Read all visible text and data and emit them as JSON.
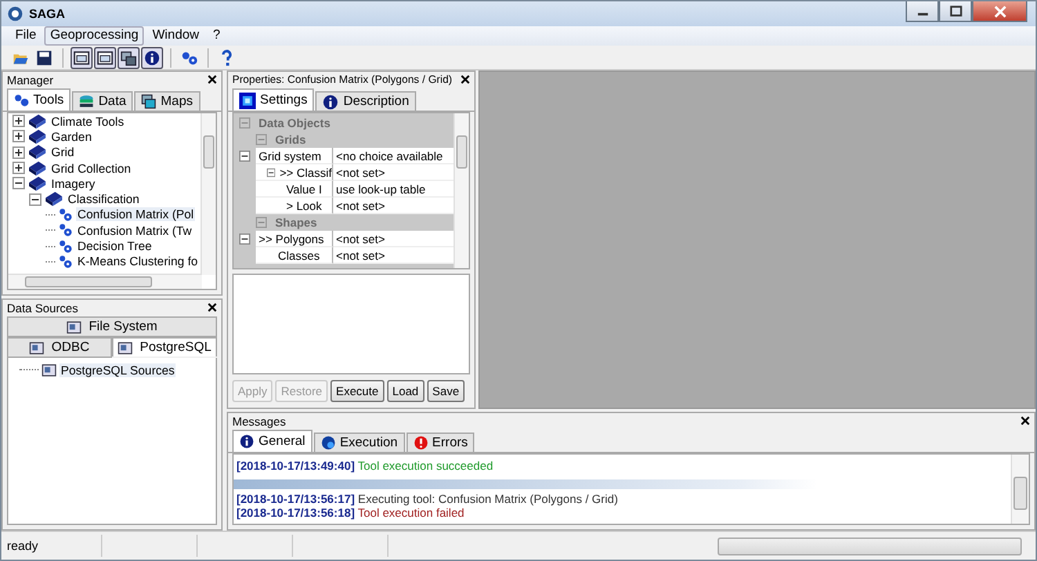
{
  "window": {
    "title": "SAGA"
  },
  "menu": [
    {
      "label": "File",
      "selected": false
    },
    {
      "label": "Geoprocessing",
      "selected": true
    },
    {
      "label": "Window",
      "selected": false
    },
    {
      "label": "?",
      "selected": false
    }
  ],
  "toolbar": [
    {
      "kind": "open",
      "pressed": false
    },
    {
      "kind": "save",
      "pressed": false
    },
    {
      "kind": "sep"
    },
    {
      "kind": "window",
      "pressed": true
    },
    {
      "kind": "window",
      "pressed": true
    },
    {
      "kind": "layers",
      "pressed": true
    },
    {
      "kind": "info",
      "pressed": true
    },
    {
      "kind": "sep"
    },
    {
      "kind": "gears",
      "pressed": false
    },
    {
      "kind": "sep"
    },
    {
      "kind": "help",
      "pressed": false
    }
  ],
  "manager": {
    "title": "Manager",
    "tabs": [
      {
        "label": "Tools",
        "kind": "gears",
        "selected": true
      },
      {
        "label": "Data",
        "kind": "data",
        "selected": false
      },
      {
        "label": "Maps",
        "kind": "maps",
        "selected": false
      }
    ],
    "tree": [
      {
        "label": "Climate Tools",
        "kind": "library",
        "expanded": false,
        "selected": false
      },
      {
        "label": "Garden",
        "kind": "library",
        "expanded": false,
        "selected": false
      },
      {
        "label": "Grid",
        "kind": "library",
        "expanded": false,
        "selected": false
      },
      {
        "label": "Grid Collection",
        "kind": "library",
        "expanded": false,
        "selected": false
      },
      {
        "label": "Imagery",
        "kind": "library",
        "expanded": true,
        "selected": false,
        "children": [
          {
            "label": "Classification",
            "kind": "library",
            "expanded": true,
            "selected": false,
            "children": [
              {
                "label": "Confusion Matrix (Pol",
                "kind": "tool",
                "selected": true
              },
              {
                "label": "Confusion Matrix (Tw",
                "kind": "tool",
                "selected": false
              },
              {
                "label": "Decision Tree",
                "kind": "tool",
                "selected": false
              },
              {
                "label": "K-Means Clustering fo",
                "kind": "tool",
                "selected": false
              }
            ]
          }
        ]
      }
    ]
  },
  "data_sources": {
    "title": "Data Sources",
    "tab_rows": [
      [
        {
          "label": "File System",
          "selected": false
        }
      ],
      [
        {
          "label": "ODBC",
          "selected": false
        },
        {
          "label": "PostgreSQL",
          "selected": true
        }
      ]
    ],
    "tree": [
      {
        "label": "PostgreSQL Sources"
      }
    ]
  },
  "properties": {
    "title": "Properties: Confusion Matrix (Polygons / Grid)",
    "tabs": [
      {
        "label": "Settings",
        "kind": "settings",
        "selected": true
      },
      {
        "label": "Description",
        "kind": "info",
        "selected": false
      }
    ],
    "rows": [
      {
        "kind": "category",
        "name": "Data Objects",
        "expanded": true,
        "children": [
          {
            "kind": "group",
            "name": "Grids",
            "expanded": true,
            "children": [
              {
                "kind": "param",
                "name": "Grid system",
                "value": "<no choice available",
                "expanded": true,
                "children": [
                  {
                    "kind": "param",
                    "name": ">> Classif",
                    "value": "<not set>",
                    "expanded": true,
                    "children": [
                      {
                        "kind": "param",
                        "name": "Value I",
                        "value": "use look-up table"
                      },
                      {
                        "kind": "param",
                        "name": "> Look",
                        "value": "<not set>"
                      }
                    ]
                  }
                ]
              }
            ]
          },
          {
            "kind": "group",
            "name": "Shapes",
            "expanded": true,
            "children": [
              {
                "kind": "param",
                "name": ">> Polygons",
                "value": "<not set>",
                "expanded": true,
                "children": [
                  {
                    "kind": "param",
                    "name": "Classes",
                    "value": "<not set>"
                  }
                ]
              }
            ]
          }
        ]
      }
    ],
    "buttons": [
      {
        "label": "Apply",
        "disabled": true
      },
      {
        "label": "Restore",
        "disabled": true
      },
      {
        "label": "Execute",
        "disabled": false
      },
      {
        "label": "Load",
        "disabled": false
      },
      {
        "label": "Save",
        "disabled": false
      }
    ]
  },
  "messages": {
    "title": "Messages",
    "tabs": [
      {
        "label": "General",
        "kind": "info",
        "selected": true
      },
      {
        "label": "Execution",
        "kind": "exec",
        "selected": false
      },
      {
        "label": "Errors",
        "kind": "error",
        "selected": false
      }
    ],
    "lines": [
      {
        "kind": "line",
        "time": "[2018-10-17/13:49:40]",
        "text": "Tool execution succeeded",
        "color": "#1e9a2a"
      },
      {
        "kind": "divider"
      },
      {
        "kind": "line",
        "time": "[2018-10-17/13:56:17]",
        "text": "Executing tool: Confusion Matrix (Polygons / Grid)",
        "color": "#333333"
      },
      {
        "kind": "line",
        "time": "[2018-10-17/13:56:18]",
        "text": "Tool execution failed",
        "color": "#a02020"
      }
    ]
  },
  "status_bar": {
    "text": "ready"
  }
}
